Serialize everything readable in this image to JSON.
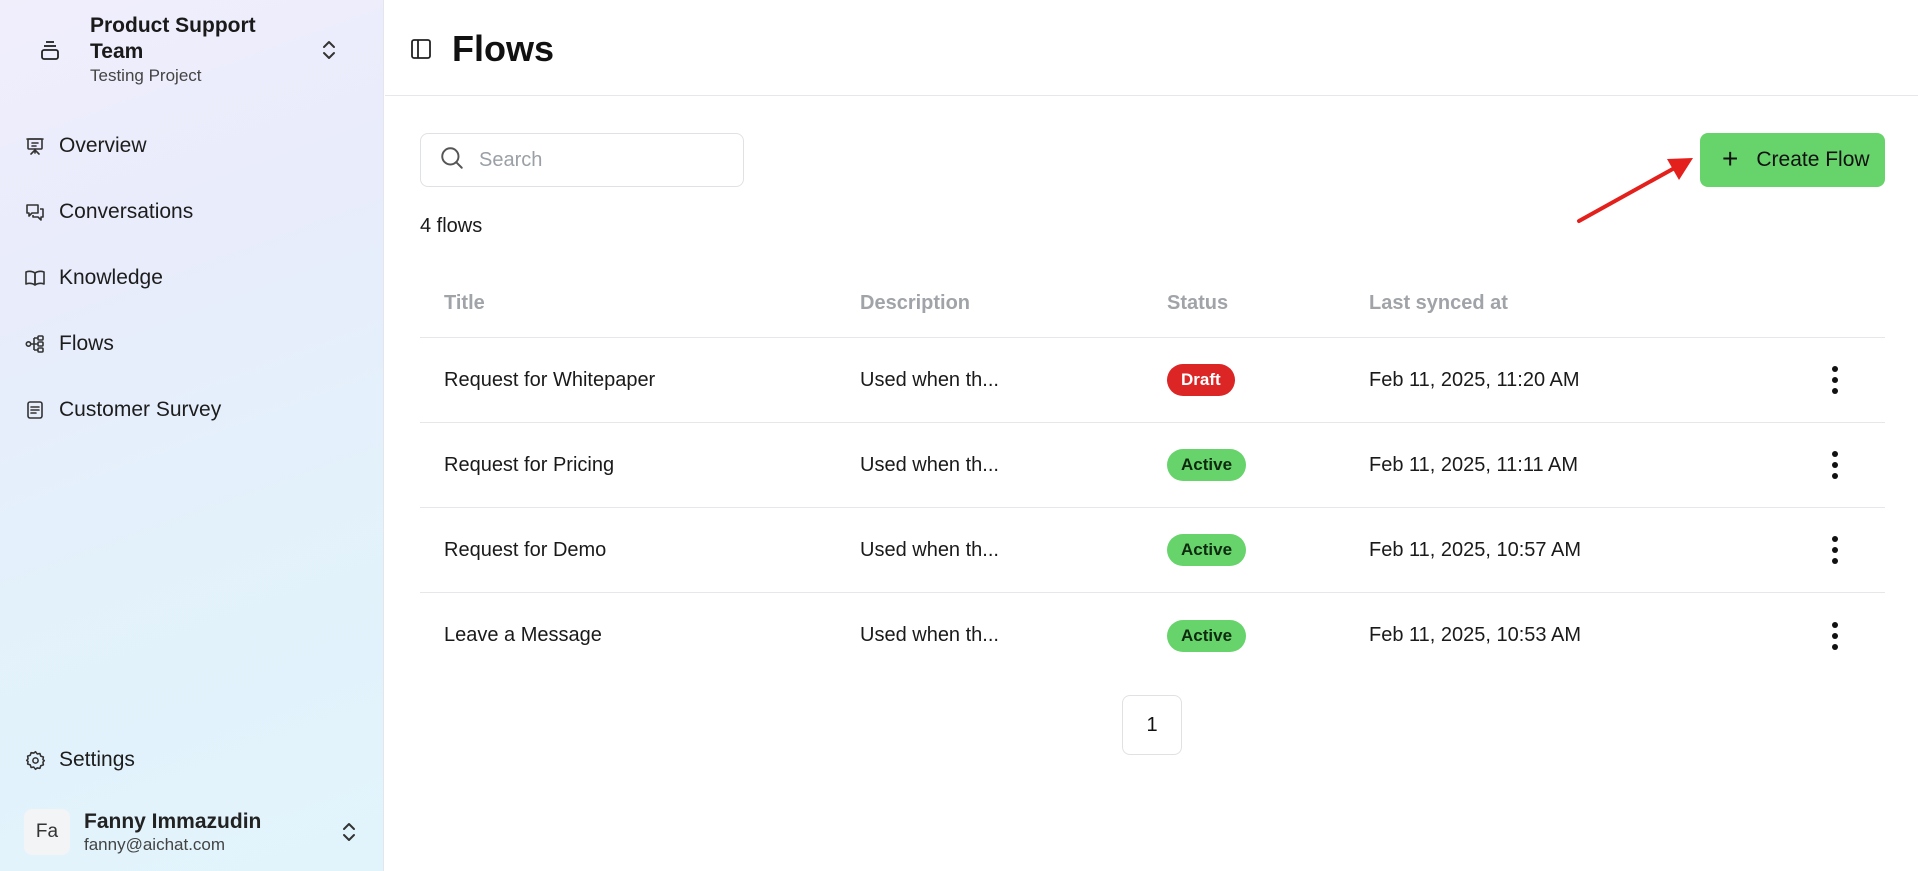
{
  "team": {
    "name": "Product Support Team",
    "project": "Testing Project"
  },
  "nav": {
    "items": [
      {
        "label": "Overview",
        "icon": "presentation-icon"
      },
      {
        "label": "Conversations",
        "icon": "chat-bubbles-icon"
      },
      {
        "label": "Knowledge",
        "icon": "book-open-icon"
      },
      {
        "label": "Flows",
        "icon": "workflow-icon"
      },
      {
        "label": "Customer Survey",
        "icon": "survey-icon"
      }
    ]
  },
  "settings": {
    "label": "Settings",
    "icon": "gear-icon"
  },
  "user": {
    "initials": "Fa",
    "name": "Fanny Immazudin",
    "email": "fanny@aichat.com"
  },
  "header": {
    "title": "Flows",
    "toggle_icon": "sidebar-toggle-icon"
  },
  "search": {
    "placeholder": "Search",
    "value": ""
  },
  "create_button": {
    "label": "Create Flow",
    "icon": "plus-icon",
    "color": "#66d46a"
  },
  "flows_count": "4 flows",
  "table": {
    "columns": [
      "Title",
      "Description",
      "Status",
      "Last synced at"
    ],
    "rows": [
      {
        "title": "Request for Whitepaper",
        "description": "Used when th...",
        "status": "Draft",
        "status_color": "#dc2626",
        "synced": "Feb 11, 2025, 11:20 AM"
      },
      {
        "title": "Request for Pricing",
        "description": "Used when th...",
        "status": "Active",
        "status_color": "#66d46a",
        "synced": "Feb 11, 2025, 11:11 AM"
      },
      {
        "title": "Request for Demo",
        "description": "Used when th...",
        "status": "Active",
        "status_color": "#66d46a",
        "synced": "Feb 11, 2025, 10:57 AM"
      },
      {
        "title": "Leave a Message",
        "description": "Used when th...",
        "status": "Active",
        "status_color": "#66d46a",
        "synced": "Feb 11, 2025, 10:53 AM"
      }
    ]
  },
  "pagination": {
    "current_page": "1"
  },
  "annotation": {
    "arrow_color": "#e3201b"
  }
}
